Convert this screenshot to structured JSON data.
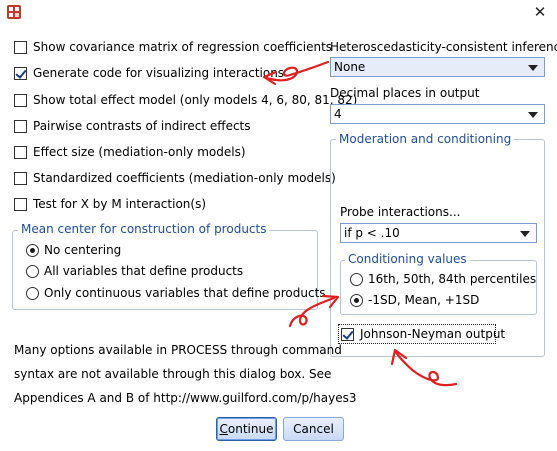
{
  "window": {
    "close_glyph": "✕",
    "icon": "spss-icon"
  },
  "left_options": [
    {
      "label": "Show covariance matrix of regression coefficients",
      "checked": false
    },
    {
      "label": "Generate code for visualizing interactions",
      "checked": true
    },
    {
      "label": "Show total effect model (only models 4, 6, 80, 81, 82)",
      "checked": false
    },
    {
      "label": "Pairwise contrasts of indirect effects",
      "checked": false
    },
    {
      "label": "Effect size (mediation-only models)",
      "checked": false
    },
    {
      "label": "Standardized coefficients (mediation-only models)",
      "checked": false
    },
    {
      "label": "Test for X by M interaction(s)",
      "checked": false
    }
  ],
  "mean_center": {
    "title": "Mean center for construction of products",
    "options": [
      {
        "label": "No centering",
        "selected": true
      },
      {
        "label": "All variables that define products",
        "selected": false
      },
      {
        "label": "Only continuous variables that define products",
        "selected": false
      }
    ]
  },
  "hc_inference": {
    "label": "Heteroscedasticity-consistent inference",
    "value": "None"
  },
  "decimal_places": {
    "label": "Decimal places in output",
    "value": "4"
  },
  "moderation": {
    "title": "Moderation and conditioning",
    "probe_label": "Probe interactions...",
    "probe_value": "if p < .10",
    "conditioning": {
      "title": "Conditioning values",
      "options": [
        {
          "label": "16th, 50th, 84th percentiles",
          "selected": false
        },
        {
          "label": "-1SD, Mean, +1SD",
          "selected": true
        }
      ]
    },
    "johnson_neyman": {
      "label": "Johnson-Neyman output",
      "checked": true
    }
  },
  "note_lines": [
    "Many options available in PROCESS through command",
    "syntax are not available through this dialog box.  See",
    "Appendices A and B of http://www.guilford.com/p/hayes3"
  ],
  "buttons": {
    "continue": {
      "pre": "",
      "accel": "C",
      "post": "ontinue"
    },
    "cancel": {
      "label": "Cancel"
    }
  },
  "colors": {
    "group_title": "#1f4e9e",
    "annotation": "#e02020",
    "button_border": "#8aa7d8"
  }
}
